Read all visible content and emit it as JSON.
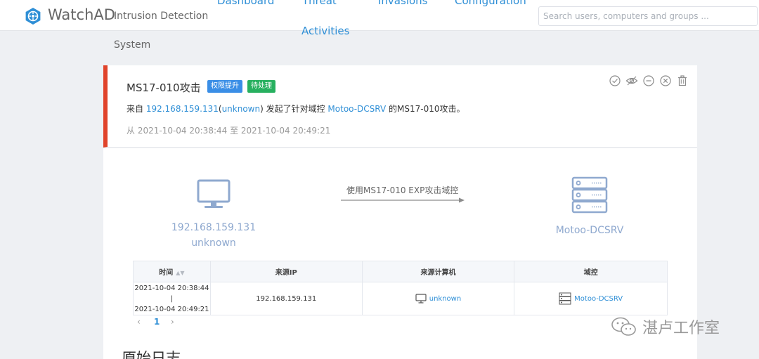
{
  "navbar": {
    "brand": "WatchAD",
    "subtitle_line1": "Intrusion Detection",
    "subtitle_line2": "System",
    "links": {
      "dashboard": "Dashboard",
      "threat": "Threat",
      "activities": "Activities",
      "invasions": "Invasions",
      "configuration": "Configuration"
    },
    "search_placeholder": "Search users, computers and groups ..."
  },
  "alert": {
    "title": "MS17-010攻击",
    "tag_privilege": "权限提升",
    "tag_status": "待处理",
    "desc_prefix": "来自 ",
    "source_ip": "192.168.159.131",
    "paren_open": "(",
    "source_host": "unknown",
    "desc_mid": ") 发起了针对域控 ",
    "target_dc": "Motoo-DCSRV",
    "desc_suffix": " 的MS17-010攻击。",
    "time_range": "从 2021-10-04 20:38:44 至 2021-10-04 20:49:21",
    "accent_color": "#e0432a"
  },
  "diagram": {
    "source_ip": "192.168.159.131",
    "source_host": "unknown",
    "arrow_label": "使用MS17-010 EXP攻击域控",
    "target": "Motoo-DCSRV",
    "node_color": "#8fa9cf"
  },
  "table": {
    "headers": {
      "time": "时间",
      "source_ip": "来源IP",
      "source_host": "来源计算机",
      "dc": "域控"
    },
    "rows": [
      {
        "time_start": "2021-10-04 20:38:44",
        "time_sep": "|",
        "time_end": "2021-10-04 20:49:21",
        "source_ip": "192.168.159.131",
        "source_host": "unknown",
        "dc": "Motoo-DCSRV"
      }
    ]
  },
  "pager": {
    "prev": "‹",
    "page": "1",
    "next": "›"
  },
  "section_title": "原始日志",
  "watermark": "湛卢工作室",
  "icons": [
    "logo-icon",
    "check-icon",
    "eye-icon",
    "minus-circle-icon",
    "close-circle-icon",
    "trash-icon",
    "monitor-icon",
    "server-icon",
    "sort-icon",
    "wechat-icon"
  ]
}
